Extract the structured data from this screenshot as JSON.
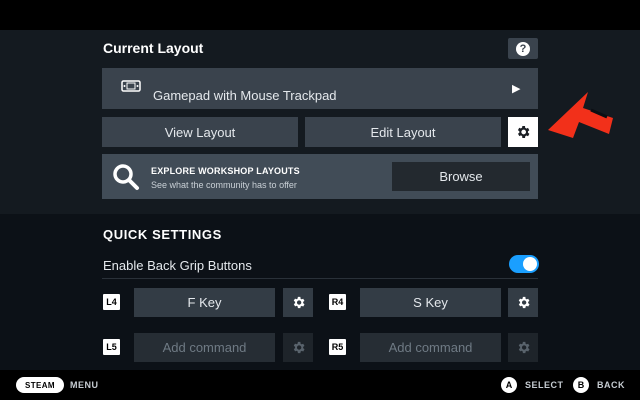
{
  "current_layout": {
    "title": "Current Layout",
    "help_icon": "question-mark-icon",
    "layout_name": "Gamepad with Mouse Trackpad",
    "view_button": "View Layout",
    "edit_button": "Edit Layout"
  },
  "workshop": {
    "title": "EXPLORE WORKSHOP LAYOUTS",
    "subtitle": "See what the community has to offer",
    "browse_button": "Browse"
  },
  "quick_settings": {
    "title": "QUICK SETTINGS",
    "back_grip_label": "Enable Back Grip Buttons",
    "back_grip_enabled": true,
    "mappings": [
      {
        "badge": "L4",
        "command": "F Key",
        "assigned": true
      },
      {
        "badge": "R4",
        "command": "S Key",
        "assigned": true
      },
      {
        "badge": "L5",
        "command": "Add command",
        "assigned": false
      },
      {
        "badge": "R5",
        "command": "Add command",
        "assigned": false
      }
    ]
  },
  "footer": {
    "steam_label": "STEAM",
    "menu_label": "MENU",
    "a_glyph": "A",
    "select_label": "SELECT",
    "b_glyph": "B",
    "back_label": "BACK"
  },
  "colors": {
    "accent_blue": "#1a9fff",
    "annotation_arrow": "#f2301a"
  }
}
